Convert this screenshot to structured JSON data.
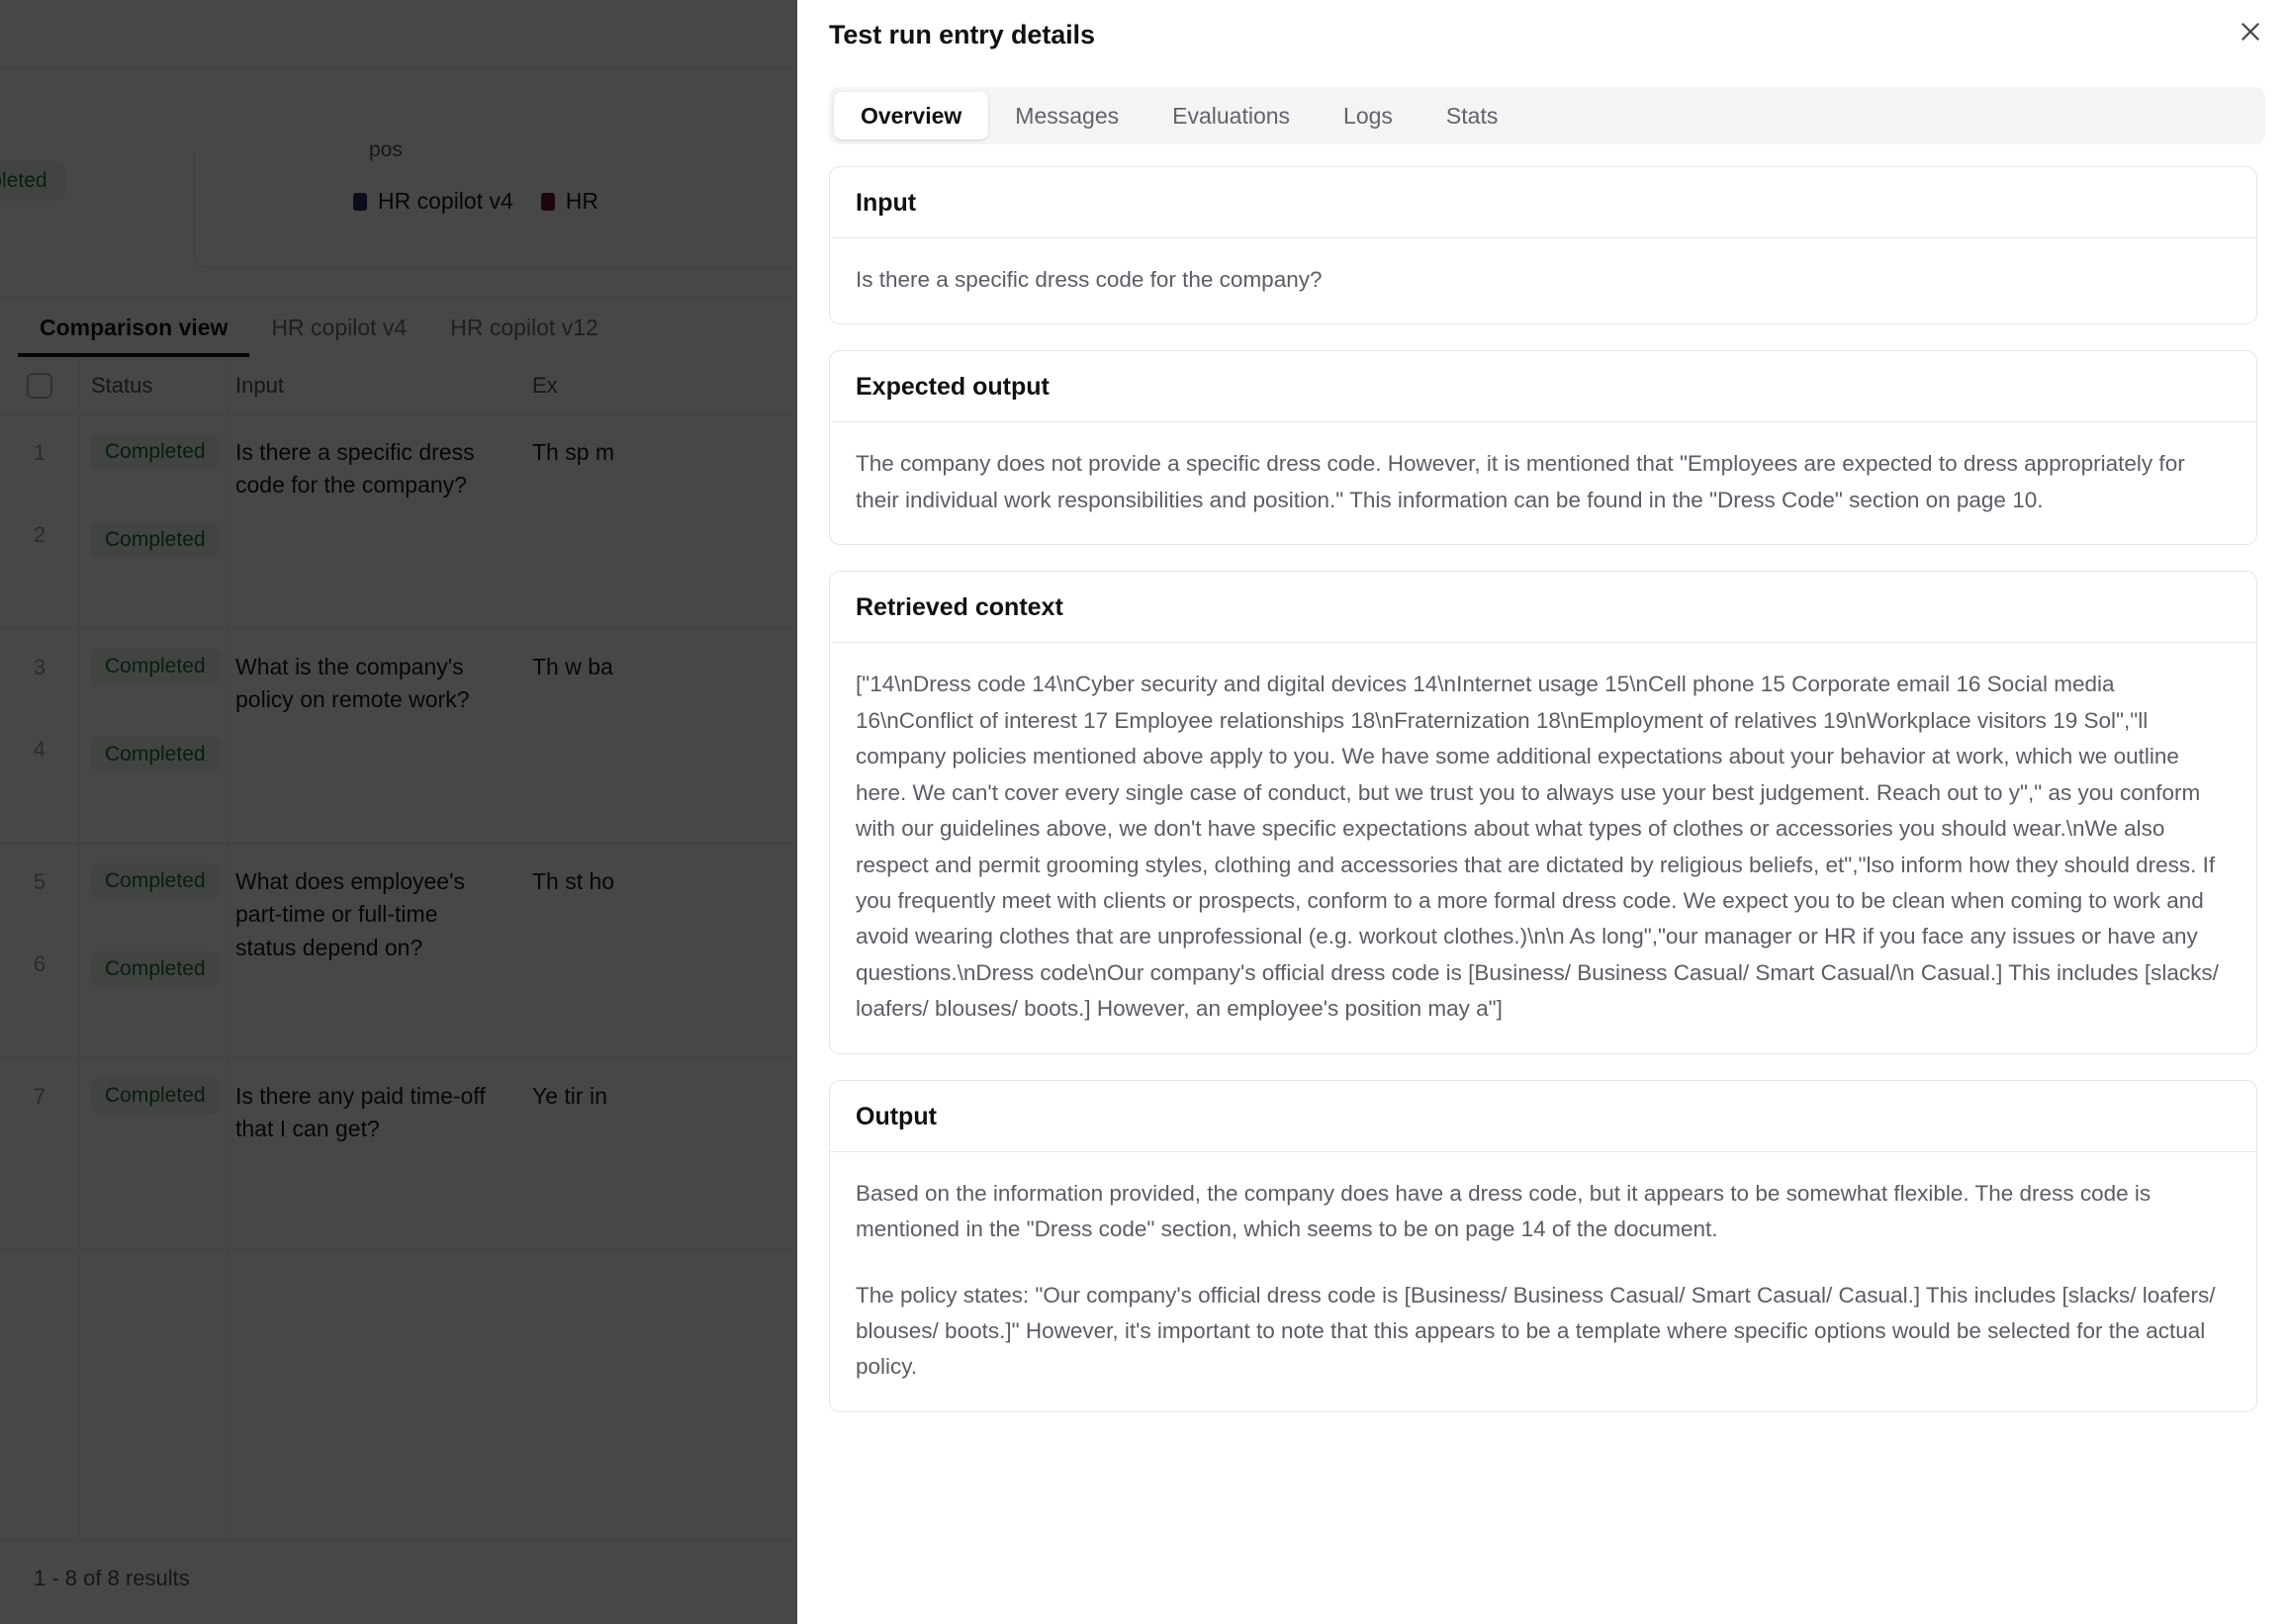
{
  "background": {
    "status_chip": "Completed",
    "chart": {
      "axis_label": "pos",
      "legend": [
        {
          "label": "HR copilot v4",
          "color": "#2b2f5e"
        },
        {
          "label": "HR",
          "color": "#6b1236"
        }
      ]
    },
    "tabs": [
      {
        "label": "Comparison view",
        "active": true
      },
      {
        "label": "HR copilot v4",
        "active": false
      },
      {
        "label": "HR copilot v12",
        "active": false
      }
    ],
    "table": {
      "columns": [
        "Status",
        "Input",
        "Ex"
      ],
      "rows": [
        {
          "num": "1",
          "status": "Completed",
          "input": "Is there a specific dress code for the company?",
          "expected": "Th sp m"
        },
        {
          "num": "2",
          "status": "Completed",
          "input": "",
          "expected": ""
        },
        {
          "num": "3",
          "status": "Completed",
          "input": "What is the company's policy on remote work?",
          "expected": "Th w ba"
        },
        {
          "num": "4",
          "status": "Completed",
          "input": "",
          "expected": ""
        },
        {
          "num": "5",
          "status": "Completed",
          "input": "What does employee's part-time or full-time status depend on?",
          "expected": "Th st ho"
        },
        {
          "num": "6",
          "status": "Completed",
          "input": "",
          "expected": ""
        },
        {
          "num": "7",
          "status": "Completed",
          "input": "Is there any paid time-off that I can get?",
          "expected": "Ye tir in"
        }
      ]
    },
    "footer": "1 - 8 of 8 results"
  },
  "panel": {
    "title": "Test run entry details",
    "close_icon": "close-icon",
    "tabs": [
      {
        "label": "Overview",
        "active": true
      },
      {
        "label": "Messages",
        "active": false
      },
      {
        "label": "Evaluations",
        "active": false
      },
      {
        "label": "Logs",
        "active": false
      },
      {
        "label": "Stats",
        "active": false
      }
    ],
    "sections": {
      "input": {
        "title": "Input",
        "body": "Is there a specific dress code for the company?"
      },
      "expected_output": {
        "title": "Expected output",
        "body": "The company does not provide a specific dress code. However, it is mentioned that \"Employees are expected to dress appropriately for their individual work responsibilities and position.\" This information can be found in the \"Dress Code\" section on page 10."
      },
      "retrieved_context": {
        "title": "Retrieved context",
        "body": "[\"14\\nDress code 14\\nCyber security and digital devices 14\\nInternet usage 15\\nCell phone 15 Corporate email 16 Social media 16\\nConflict of interest 17 Employee relationships 18\\nFraternization 18\\nEmployment of relatives 19\\nWorkplace visitors 19 Sol\",\"ll company policies mentioned above apply to you. We have some additional expectations about your behavior at work, which we outline here. We can't cover every single case of conduct, but we trust you to always use your best judgement. Reach out to y\",\" as you conform with our guidelines above, we don't have specific expectations about what types of clothes or accessories you should wear.\\nWe also respect and permit grooming styles, clothing and accessories that are dictated by religious beliefs, et\",\"lso inform how they should dress. If you frequently meet with clients or prospects, conform to a more formal dress code. We expect you to be clean when coming to work and avoid wearing clothes that are unprofessional (e.g. workout clothes.)\\n\\n As long\",\"our manager or HR if you face any issues or have any questions.\\nDress code\\nOur company's official dress code is [Business/ Business Casual/ Smart Casual/\\n Casual.] This includes [slacks/ loafers/ blouses/ boots.] However, an employee's position may a\"]"
      },
      "output": {
        "title": "Output",
        "paragraph_1": "Based on the information provided, the company does have a dress code, but it appears to be somewhat flexible. The dress code is mentioned in the \"Dress code\" section, which seems to be on page 14 of the document.",
        "paragraph_2": "The policy states: \"Our company's official dress code is [Business/ Business Casual/ Smart Casual/ Casual.] This includes [slacks/ loafers/ blouses/ boots.]\" However, it's important to note that this appears to be a template where specific options would be selected for the actual policy."
      }
    }
  }
}
